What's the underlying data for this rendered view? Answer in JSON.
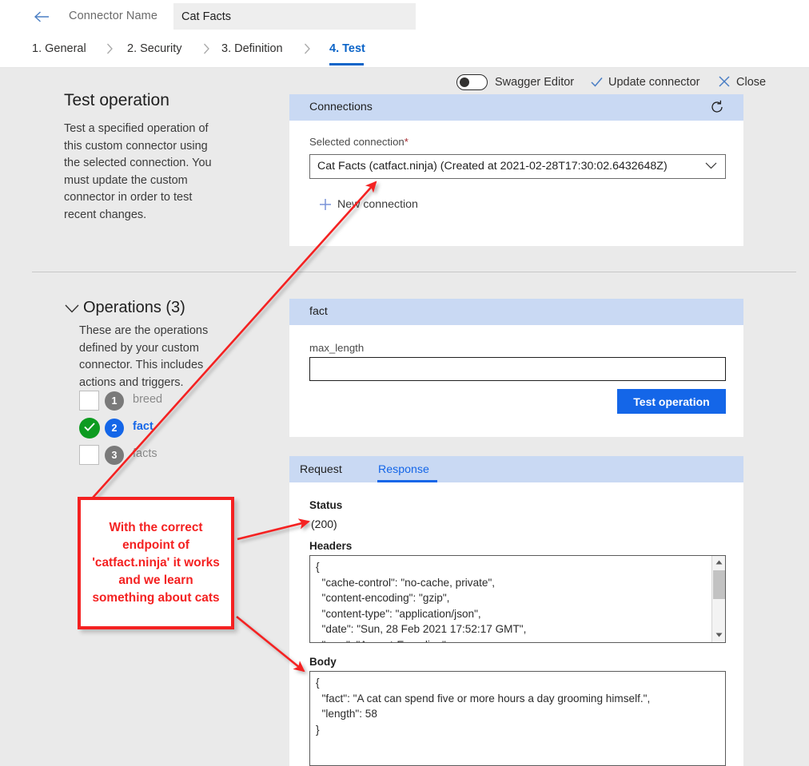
{
  "topbar": {
    "back_icon": "back-arrow-icon",
    "connector_name_label": "Connector Name",
    "connector_name_value": "Cat Facts",
    "connector_name_placeholder": "Connector Name"
  },
  "stepnav": {
    "steps": [
      {
        "label": "1. General",
        "active": false
      },
      {
        "label": "2. Security",
        "active": false
      },
      {
        "label": "3. Definition",
        "active": false
      },
      {
        "label": "4. Test",
        "active": true
      }
    ],
    "swagger_toggle": {
      "label": "Swagger Editor",
      "state": "off"
    },
    "update_connector": "Update connector",
    "close": "Close",
    "accent_color": "#0b64c8"
  },
  "left": {
    "title": "Test operation",
    "description": "Test a specified operation of this custom connector using the selected connection. You must update the custom connector in order to test recent changes.",
    "operations_title": "Operations (3)",
    "operations_description": "These are the operations defined by your custom connector. This includes actions and triggers.",
    "operations": [
      {
        "num": "1",
        "label": "breed",
        "checked": false,
        "active": false
      },
      {
        "num": "2",
        "label": "fact",
        "checked": true,
        "active": true
      },
      {
        "num": "3",
        "label": "facts",
        "checked": false,
        "active": false
      }
    ]
  },
  "connections_panel": {
    "header": "Connections",
    "refresh_icon": "refresh-icon",
    "selected_connection_label": "Selected connection",
    "required_marker": "*",
    "selected_connection_value": "Cat Facts (catfact.ninja) (Created at 2021-02-28T17:30:02.6432648Z)",
    "new_connection": "New connection"
  },
  "operation_panel": {
    "header": "fact",
    "param_label": "max_length",
    "param_value": "",
    "param_placeholder": "",
    "test_button": "Test operation",
    "button_color": "#1466e8"
  },
  "response_panel": {
    "tabs": [
      {
        "label": "Request",
        "active": false
      },
      {
        "label": "Response",
        "active": true
      }
    ],
    "status_label": "Status",
    "status_value": "(200)",
    "headers_label": "Headers",
    "headers_value": "{\n  \"cache-control\": \"no-cache, private\",\n  \"content-encoding\": \"gzip\",\n  \"content-type\": \"application/json\",\n  \"date\": \"Sun, 28 Feb 2021 17:52:17 GMT\",\n  \"vary\": \"Accept-Encoding\"\n}",
    "body_label": "Body",
    "body_value": "{\n  \"fact\": \"A cat can spend five or more hours a day grooming himself.\",\n  \"length\": 58\n}"
  },
  "annotation": {
    "text": "With the correct endpoint of 'catfact.ninja' it works and we learn something about cats",
    "color": "#f42121"
  }
}
